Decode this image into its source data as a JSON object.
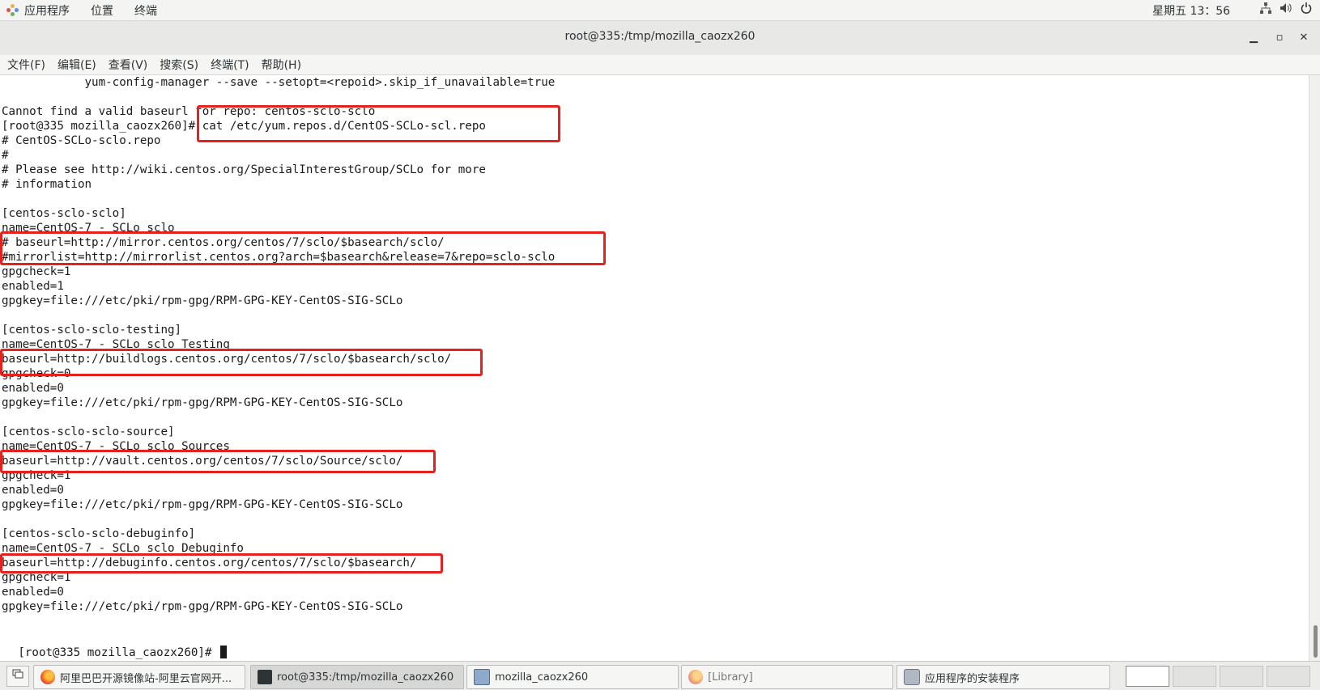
{
  "top_panel": {
    "applications": "应用程序",
    "places": "位置",
    "terminal": "终端",
    "clock": "星期五 13：56",
    "tray_icons": [
      "network-icon",
      "volume-icon",
      "power-icon"
    ]
  },
  "window": {
    "title": "root@335:/tmp/mozilla_caozx260",
    "minimize": "▁",
    "maximize": "▫",
    "close": "✕"
  },
  "menubar": [
    "文件(F)",
    "编辑(E)",
    "查看(V)",
    "搜索(S)",
    "终端(T)",
    "帮助(H)"
  ],
  "terminal_lines": [
    "            yum-config-manager --save --setopt=<repoid>.skip_if_unavailable=true",
    "",
    "Cannot find a valid baseurl for repo: centos-sclo-sclo",
    "[root@335 mozilla_caozx260]# cat /etc/yum.repos.d/CentOS-SCLo-scl.repo",
    "# CentOS-SCLo-sclo.repo",
    "#",
    "# Please see http://wiki.centos.org/SpecialInterestGroup/SCLo for more",
    "# information",
    "",
    "[centos-sclo-sclo]",
    "name=CentOS-7 - SCLo sclo",
    "# baseurl=http://mirror.centos.org/centos/7/sclo/$basearch/sclo/",
    "#mirrorlist=http://mirrorlist.centos.org?arch=$basearch&release=7&repo=sclo-sclo",
    "gpgcheck=1",
    "enabled=1",
    "gpgkey=file:///etc/pki/rpm-gpg/RPM-GPG-KEY-CentOS-SIG-SCLo",
    "",
    "[centos-sclo-sclo-testing]",
    "name=CentOS-7 - SCLo sclo Testing",
    "baseurl=http://buildlogs.centos.org/centos/7/sclo/$basearch/sclo/",
    "gpgcheck=0",
    "enabled=0",
    "gpgkey=file:///etc/pki/rpm-gpg/RPM-GPG-KEY-CentOS-SIG-SCLo",
    "",
    "[centos-sclo-sclo-source]",
    "name=CentOS-7 - SCLo sclo Sources",
    "baseurl=http://vault.centos.org/centos/7/sclo/Source/sclo/",
    "gpgcheck=1",
    "enabled=0",
    "gpgkey=file:///etc/pki/rpm-gpg/RPM-GPG-KEY-CentOS-SIG-SCLo",
    "",
    "[centos-sclo-sclo-debuginfo]",
    "name=CentOS-7 - SCLo sclo Debuginfo",
    "baseurl=http://debuginfo.centos.org/centos/7/sclo/$basearch/",
    "gpgcheck=1",
    "enabled=0",
    "gpgkey=file:///etc/pki/rpm-gpg/RPM-GPG-KEY-CentOS-SIG-SCLo",
    "",
    "[root@335 mozilla_caozx260]# "
  ],
  "highlight_color": "#e5201d",
  "taskbar": {
    "tasks": [
      {
        "label": "阿里巴巴开源镜像站-阿里云官网开...",
        "icon": "firefox-icon"
      },
      {
        "label": "root@335:/tmp/mozilla_caozx260",
        "icon": "terminal-icon"
      },
      {
        "label": "mozilla_caozx260",
        "icon": "file-manager-icon"
      },
      {
        "label": "[Library]",
        "icon": "firefox-icon"
      },
      {
        "label": "应用程序的安装程序",
        "icon": "software-installer-icon"
      }
    ],
    "workspaces": 4,
    "current_workspace": 1
  }
}
